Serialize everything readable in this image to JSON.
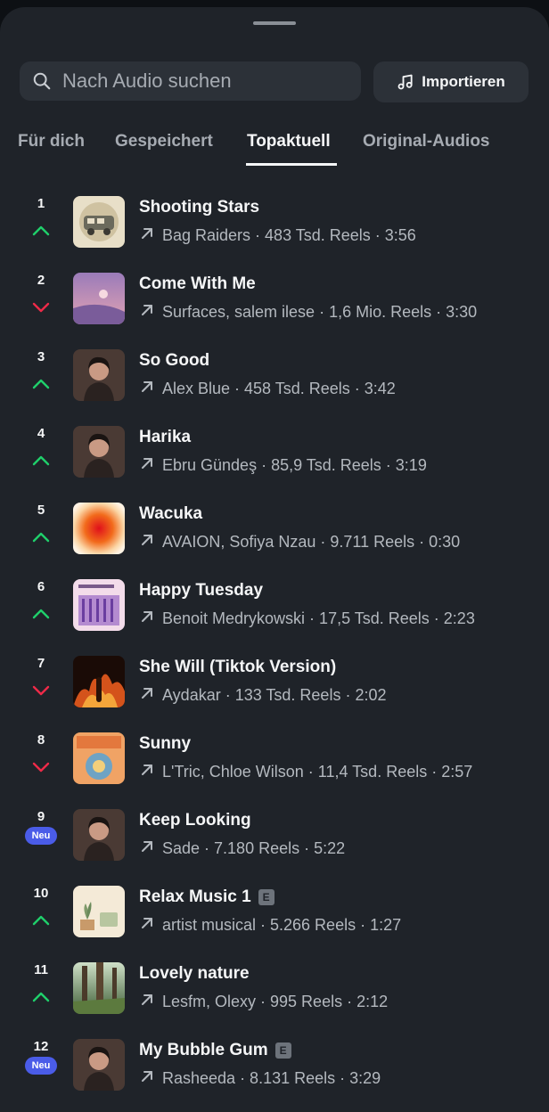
{
  "search": {
    "placeholder": "Nach Audio suchen"
  },
  "import_button": {
    "label": "Importieren"
  },
  "tabs": [
    {
      "label": "Für dich"
    },
    {
      "label": "Gespeichert"
    },
    {
      "label": "Topaktuell"
    },
    {
      "label": "Original-Audios"
    }
  ],
  "active_tab": "Topaktuell",
  "colors": {
    "up": "#1fcf6b",
    "down": "#ee2a48",
    "new_badge": "#4a5ce8"
  },
  "tracks": [
    {
      "rank": "1",
      "trend": "up",
      "title": "Shooting Stars",
      "explicit": false,
      "meta": "Bag Raiders · 483 Tsd. Reels · 3:56",
      "cover": "vintage-van-cover"
    },
    {
      "rank": "2",
      "trend": "down",
      "title": "Come With Me",
      "explicit": false,
      "meta": "Surfaces, salem ilese · 1,6 Mio. Reels · 3:30",
      "cover": "purple-sunset-cover"
    },
    {
      "rank": "3",
      "trend": "up",
      "title": "So Good",
      "explicit": false,
      "meta": "Alex Blue · 458 Tsd. Reels · 3:42",
      "cover": "portrait-cover"
    },
    {
      "rank": "4",
      "trend": "up",
      "title": "Harika",
      "explicit": false,
      "meta": "Ebru Gündeş · 85,9 Tsd. Reels · 3:19",
      "cover": "portrait-cover"
    },
    {
      "rank": "5",
      "trend": "up",
      "title": "Wacuka",
      "explicit": false,
      "meta": "AVAION, Sofiya Nzau · 9.711 Reels · 0:30",
      "cover": "orange-glow-cover"
    },
    {
      "rank": "6",
      "trend": "up",
      "title": "Happy Tuesday",
      "explicit": false,
      "meta": "Benoit Medrykowski · 17,5 Tsd. Reels · 2:23",
      "cover": "playlist-cover"
    },
    {
      "rank": "7",
      "trend": "down",
      "title": "She Will (Tiktok Version)",
      "explicit": false,
      "meta": "Aydakar · 133 Tsd. Reels · 2:02",
      "cover": "fire-cover"
    },
    {
      "rank": "8",
      "trend": "down",
      "title": "Sunny",
      "explicit": false,
      "meta": "L'Tric, Chloe Wilson · 11,4 Tsd. Reels · 2:57",
      "cover": "sunny-cover"
    },
    {
      "rank": "9",
      "trend": "new",
      "badge": "Neu",
      "title": "Keep Looking",
      "explicit": false,
      "meta": "Sade · 7.180 Reels · 5:22",
      "cover": "portrait-cover"
    },
    {
      "rank": "10",
      "trend": "up",
      "title": "Relax Music 1",
      "explicit": true,
      "explicit_label": "E",
      "meta": "artist musical · 5.266 Reels · 1:27",
      "cover": "relax-vibes-cover"
    },
    {
      "rank": "11",
      "trend": "up",
      "title": "Lovely nature",
      "explicit": false,
      "meta": "Lesfm, Olexy · 995 Reels · 2:12",
      "cover": "forest-cover"
    },
    {
      "rank": "12",
      "trend": "new",
      "badge": "Neu",
      "title": "My Bubble Gum",
      "explicit": true,
      "explicit_label": "E",
      "meta": "Rasheeda · 8.131 Reels · 3:29",
      "cover": "portrait-cover"
    }
  ]
}
